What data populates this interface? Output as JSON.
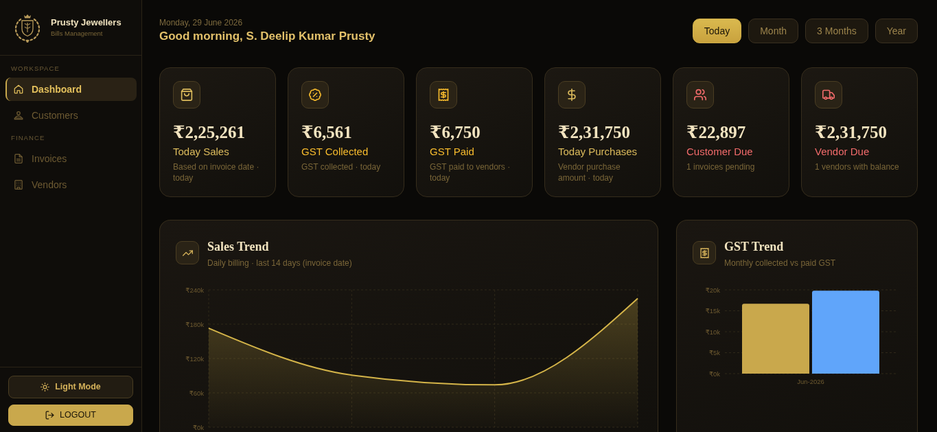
{
  "sidebar": {
    "brand": {
      "name": "Prusty Jewellers",
      "subtitle": "Bills Management"
    },
    "sections": [
      {
        "label": "WORKSPACE",
        "items": [
          {
            "label": "Dashboard",
            "selected": true
          },
          {
            "label": "Customers",
            "selected": false
          }
        ]
      },
      {
        "label": "FINANCE",
        "items": [
          {
            "label": "Invoices",
            "selected": false
          },
          {
            "label": "Vendors",
            "selected": false
          }
        ]
      }
    ],
    "buttons": [
      {
        "label": "Light Mode",
        "kind": "outline"
      },
      {
        "label": "LOGOUT",
        "kind": "primary"
      }
    ]
  },
  "header": {
    "date": "Monday, 29 June 2026",
    "greeting": "Good morning, S. Deelip Kumar Prusty"
  },
  "periods": [
    {
      "label": "Today",
      "selected": true
    },
    {
      "label": "Month",
      "selected": false
    },
    {
      "label": "3 Months",
      "selected": false
    },
    {
      "label": "Year",
      "selected": false
    }
  ],
  "stats": [
    {
      "value": "₹2,25,261",
      "label": "Today Sales",
      "note": "Based on invoice date · today",
      "color": "#dcbb5c"
    },
    {
      "value": "₹6,561",
      "label": "GST Collected",
      "note": "GST collected · today",
      "color": "#f7bb2d"
    },
    {
      "value": "₹6,750",
      "label": "GST Paid",
      "note": "GST paid to vendors · today",
      "color": "#f7bb2d"
    },
    {
      "value": "₹2,31,750",
      "label": "Today Purchases",
      "note": "Vendor purchase amount · today",
      "color": "#dcbb5c"
    },
    {
      "value": "₹22,897",
      "label": "Customer Due",
      "note": "1 invoices pending",
      "color": "#f26b6b"
    },
    {
      "value": "₹2,31,750",
      "label": "Vendor Due",
      "note": "1 vendors with balance",
      "color": "#f26b6b"
    }
  ],
  "charts": [
    {
      "title": "Sales Trend",
      "subtitle": "Daily billing · last 14 days (invoice date)",
      "chart_data": {
        "type": "area",
        "grid": true,
        "series": [
          {
            "color": "#d4b449",
            "values": [
              173000,
              91000,
              74000,
              225000
            ]
          }
        ],
        "ylim": [
          0,
          240000
        ],
        "yticks": [
          {
            "value": 0,
            "label": "₹0k"
          },
          {
            "value": 60000,
            "label": "₹60k"
          },
          {
            "value": 120000,
            "label": "₹120k"
          },
          {
            "value": 180000,
            "label": "₹180k"
          },
          {
            "value": 240000,
            "label": "₹240k"
          }
        ]
      }
    },
    {
      "title": "GST Trend",
      "subtitle": "Monthly collected vs paid GST",
      "chart_data": {
        "type": "bar",
        "grid": true,
        "categories": [
          "Jun-2026"
        ],
        "series": [
          {
            "color": "#c9a84c",
            "values": [
              16700
            ]
          },
          {
            "color": "#60a5fa",
            "values": [
              19800
            ]
          }
        ],
        "ylim": [
          0,
          20000
        ],
        "yticks": [
          {
            "value": 0,
            "label": "₹0k"
          },
          {
            "value": 5000,
            "label": "₹5k"
          },
          {
            "value": 10000,
            "label": "₹10k"
          },
          {
            "value": 15000,
            "label": "₹15k"
          },
          {
            "value": 20000,
            "label": "₹20k"
          }
        ]
      }
    }
  ]
}
